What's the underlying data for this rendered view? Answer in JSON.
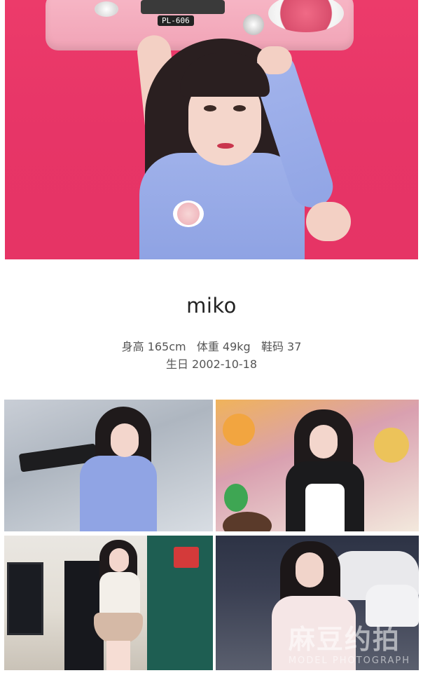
{
  "profile": {
    "name": "miko",
    "stats_line": "身高 165cm   体重 49kg   鞋码 37",
    "birthday_line": "生日 2002-10-18"
  },
  "hero": {
    "boombox_label": "PL-606",
    "background_color": "#e63666"
  },
  "gallery": {
    "photos": [
      {
        "name": "photo-1"
      },
      {
        "name": "photo-2"
      },
      {
        "name": "photo-3"
      },
      {
        "name": "photo-4"
      }
    ]
  },
  "watermark": {
    "logo_text": "麻豆约拍",
    "sub_text": "MODEL PHOTOGRAPH"
  }
}
